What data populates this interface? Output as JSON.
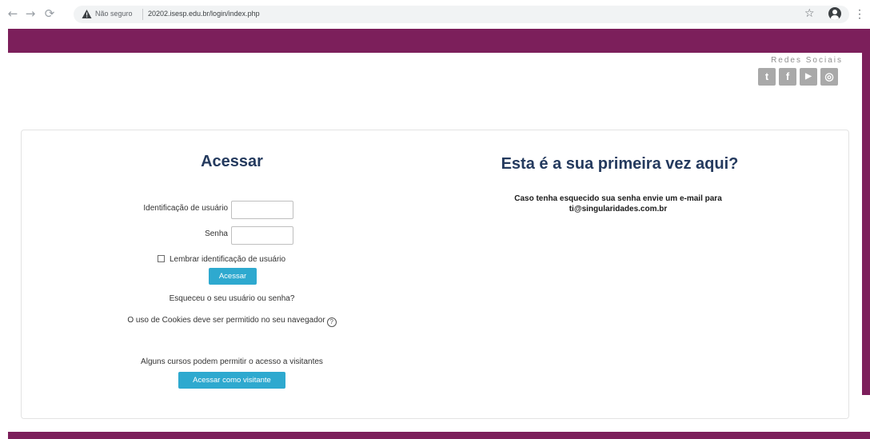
{
  "browser": {
    "security_label": "Não seguro",
    "url": "20202.isesp.edu.br/login/index.php",
    "icons": [
      "back-icon",
      "forward-icon",
      "reload-icon",
      "warning-icon",
      "star-icon",
      "profile-icon",
      "menu-icon"
    ]
  },
  "theme": {
    "brand_color": "#7c1f5b",
    "button_color": "#2ea9cf",
    "title_color": "#243a5e"
  },
  "social": {
    "title": "Redes Sociais",
    "icons": [
      {
        "name": "twitter-icon",
        "glyph": "t"
      },
      {
        "name": "facebook-icon",
        "glyph": "f"
      },
      {
        "name": "youtube-icon",
        "glyph": "▶"
      },
      {
        "name": "instagram-icon",
        "glyph": "◎"
      }
    ]
  },
  "login": {
    "title": "Acessar",
    "username_label": "Identificação de usuário",
    "username_value": "",
    "password_label": "Senha",
    "password_value": "",
    "remember_label": "Lembrar identificação de usuário",
    "remember_checked": false,
    "submit_label": "Acessar",
    "forgot_link": "Esqueceu o seu usuário ou senha?",
    "cookies_text": "O uso de Cookies deve ser permitido no seu navegador",
    "guest_text": "Alguns cursos podem permitir o acesso a visitantes",
    "guest_button": "Acessar como visitante"
  },
  "first_time": {
    "title": "Esta é a sua primeira vez aqui?",
    "text_line1": "Caso tenha esquecido sua senha envie um e-mail para",
    "text_line2": "ti@singularidades.com.br"
  }
}
